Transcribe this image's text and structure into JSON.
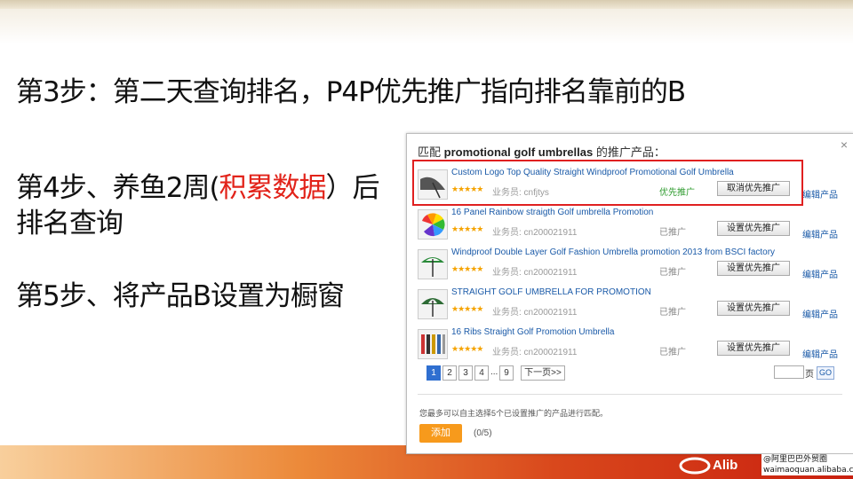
{
  "slide": {
    "step3": "第3步：第二天查询排名，P4P优先推广指向排名靠前的B",
    "step4_pre": "第4步、养鱼2周(",
    "step4_hl": "积累数据",
    "step4_post": "）后",
    "step4_line2": "排名查询",
    "step5": "第5步、将产品B设置为橱窗"
  },
  "panel": {
    "title_pre": "匹配",
    "keyword": "promotional golf umbrellas",
    "title_post": "的推广产品：",
    "close_icon": "×",
    "items": [
      {
        "title": "Custom Logo Top Quality Straight Windproof Promotional Golf Umbrella",
        "stars": "★★★★★",
        "rep": "业务员: cnfjtys",
        "status": "优先推广",
        "button": "取消优先推广",
        "edit": "编辑产品"
      },
      {
        "title": "16 Panel Rainbow straigth Golf umbrella Promotion",
        "stars": "★★★★★",
        "rep": "业务员: cn200021911",
        "status": "已推广",
        "button": "设置优先推广",
        "edit": "编辑产品"
      },
      {
        "title": "Windproof Double Layer Golf Fashion Umbrella promotion 2013 from BSCI factory",
        "stars": "★★★★★",
        "rep": "业务员: cn200021911",
        "status": "已推广",
        "button": "设置优先推广",
        "edit": "编辑产品"
      },
      {
        "title": "STRAIGHT GOLF UMBRELLA FOR PROMOTION",
        "stars": "★★★★★",
        "rep": "业务员: cn200021911",
        "status": "已推广",
        "button": "设置优先推广",
        "edit": "编辑产品"
      },
      {
        "title": "16 Ribs Straight Golf Promotion Umbrella",
        "stars": "★★★★★",
        "rep": "业务员: cn200021911",
        "status": "已推广",
        "button": "设置优先推广",
        "edit": "编辑产品"
      }
    ],
    "pager": {
      "p1": "1",
      "p2": "2",
      "p3": "3",
      "p4": "4",
      "ellipsis": "...",
      "p9": "9",
      "next": "下一页>>",
      "page_label": "页",
      "go": "GO"
    },
    "note": "您最多可以自主选择5个已设置推广的产品进行匹配。",
    "add_button": "添加",
    "count": "(0/5)"
  },
  "watermark": {
    "line1": "@阿里巴巴外贸圈",
    "line2": "waimaoquan.alibaba.com",
    "logo_text": "Alib"
  },
  "colors": {
    "highlight": "#e2231a",
    "link": "#1a5aa8",
    "add": "#f79a1c"
  }
}
